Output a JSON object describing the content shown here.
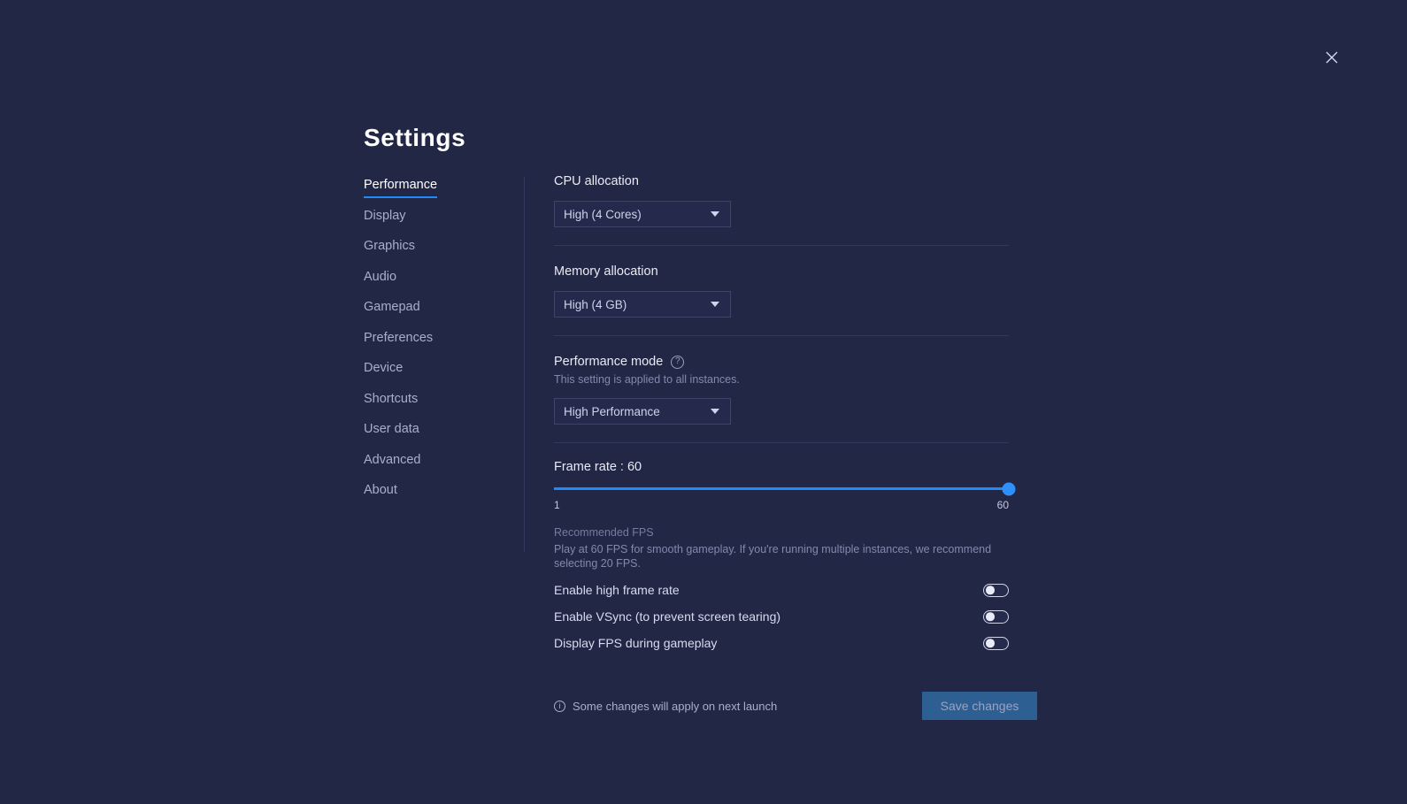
{
  "window": {
    "title": "Settings",
    "close_icon": "close-icon"
  },
  "sidebar": {
    "items": [
      {
        "label": "Performance",
        "active": true
      },
      {
        "label": "Display",
        "active": false
      },
      {
        "label": "Graphics",
        "active": false
      },
      {
        "label": "Audio",
        "active": false
      },
      {
        "label": "Gamepad",
        "active": false
      },
      {
        "label": "Preferences",
        "active": false
      },
      {
        "label": "Device",
        "active": false
      },
      {
        "label": "Shortcuts",
        "active": false
      },
      {
        "label": "User data",
        "active": false
      },
      {
        "label": "Advanced",
        "active": false
      },
      {
        "label": "About",
        "active": false
      }
    ]
  },
  "content": {
    "cpu": {
      "label": "CPU allocation",
      "value": "High (4 Cores)"
    },
    "memory": {
      "label": "Memory allocation",
      "value": "High (4 GB)"
    },
    "performance_mode": {
      "label": "Performance mode",
      "help_icon": "question-mark-icon",
      "description": "This setting is applied to all instances.",
      "value": "High Performance"
    },
    "frame_rate": {
      "label": "Frame rate : 60",
      "value": 60,
      "min": 1,
      "max": 60,
      "min_label": "1",
      "max_label": "60",
      "fill_percent": 100,
      "note_title": "Recommended FPS",
      "note_body": "Play at 60 FPS for smooth gameplay. If you're running multiple instances, we recommend selecting 20 FPS."
    },
    "toggles": [
      {
        "label": "Enable high frame rate",
        "on": false
      },
      {
        "label": "Enable VSync (to prevent screen tearing)",
        "on": false
      },
      {
        "label": "Display FPS during gameplay",
        "on": false
      }
    ],
    "footer": {
      "info_icon": "info-icon",
      "note": "Some changes will apply on next launch",
      "save_label": "Save changes"
    }
  },
  "colors": {
    "background": "#232746",
    "accent": "#1e8bfc",
    "panel": "#252a4c",
    "save_button": "#2d5f93"
  }
}
